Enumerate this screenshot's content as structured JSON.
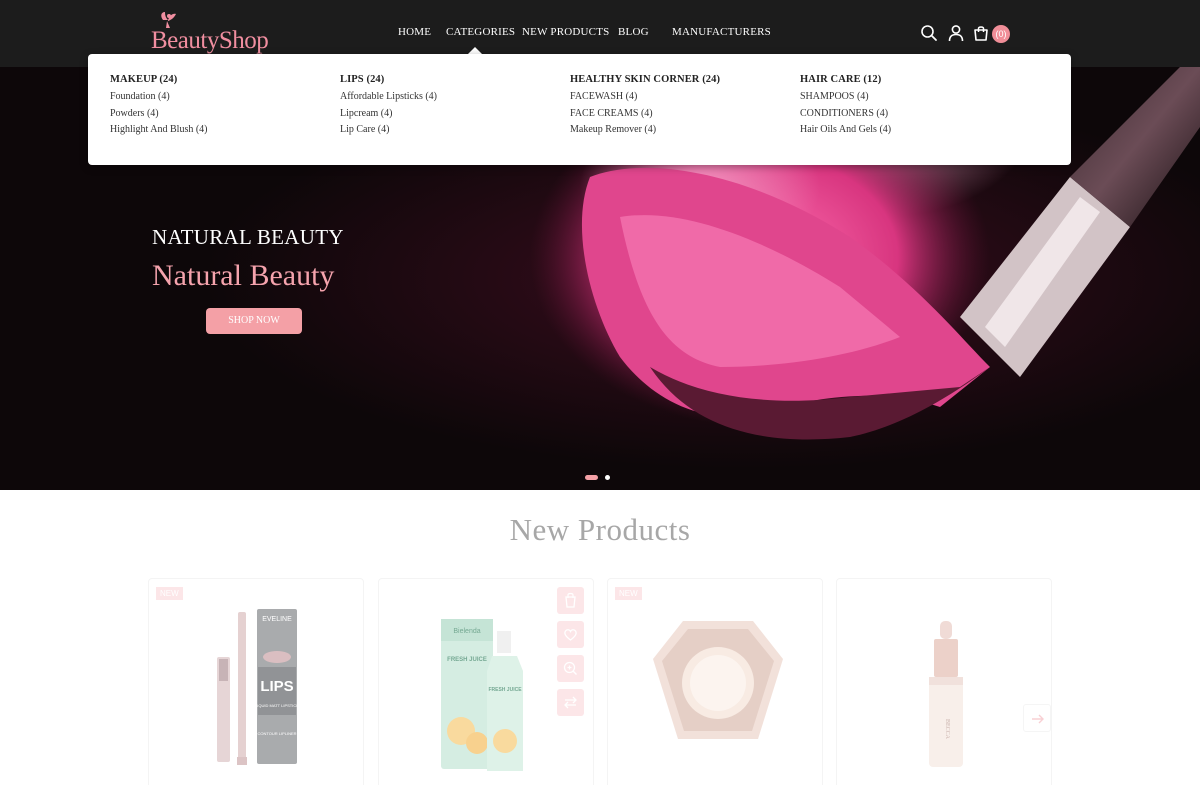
{
  "header": {
    "logo_text": "BeautyShop",
    "nav": [
      {
        "label": "HOME"
      },
      {
        "label": "CATEGORIES"
      },
      {
        "label": "NEW PRODUCTS"
      },
      {
        "label": "BLOG"
      },
      {
        "label": "MANUFACTURERS"
      }
    ],
    "icons": [
      "search-icon",
      "user-icon",
      "cart-icon"
    ],
    "cart_count": "(0)"
  },
  "dropdown": {
    "columns": [
      {
        "heading": "MAKEUP (24)",
        "items": [
          "Foundation (4)",
          "Powders (4)",
          "Highlight And Blush (4)"
        ]
      },
      {
        "heading": "LIPS (24)",
        "items": [
          "Affordable Lipsticks (4)",
          "Lipcream (4)",
          "Lip Care (4)"
        ]
      },
      {
        "heading": "HEALTHY SKIN CORNER (24)",
        "items": [
          "FACEWASH (4)",
          "FACE CREAMS (4)",
          "Makeup Remover (4)"
        ]
      },
      {
        "heading": "HAIR CARE (12)",
        "items": [
          "SHAMPOOS (4)",
          "CONDITIONERS (4)",
          "Hair Oils And Gels (4)"
        ]
      }
    ]
  },
  "hero": {
    "title": "NATURAL BEAUTY",
    "subtitle": "Natural Beauty",
    "button": "SHOP NOW",
    "slide_count": 2,
    "active_slide": 1
  },
  "products": {
    "title": "New Products",
    "badge": "NEW",
    "cards": [
      {
        "badge": "NEW",
        "product_text": [
          "EVELINE",
          "LIPS",
          "LIQUID MATT LIPSTICK",
          "CONTOUR LIPLINER"
        ]
      },
      {
        "badge": "",
        "product_text": [
          "Bielenda",
          "FRESH JUICE",
          "FRESH JUICE"
        ]
      },
      {
        "badge": "NEW",
        "product_text": []
      },
      {
        "badge": "",
        "product_text": [
          "BECCA"
        ]
      }
    ],
    "action_icons": [
      "cart-icon",
      "heart-icon",
      "zoom-icon",
      "compare-icon"
    ]
  },
  "colors": {
    "header_bg": "#1c1c1c",
    "accent_pink": "#f08e98",
    "hero_bg": "#0d0709",
    "title_gray": "#a7a7a7"
  }
}
